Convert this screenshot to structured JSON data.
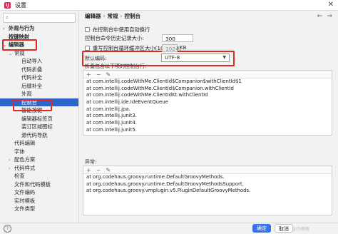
{
  "window": {
    "title": "设置",
    "app_icon": "intellij-icon"
  },
  "search": {
    "placeholder": ""
  },
  "tree": [
    {
      "label": "外观与行为",
      "level": 0,
      "arrow": "›",
      "bold": true
    },
    {
      "label": "按键映射",
      "level": 0,
      "arrow": "",
      "bold": true
    },
    {
      "label": "编辑器",
      "level": 0,
      "arrow": "⌄",
      "bold": true
    },
    {
      "label": "常规",
      "level": 1,
      "arrow": "⌄"
    },
    {
      "label": "自动导入",
      "level": 2,
      "arrow": ""
    },
    {
      "label": "代码折叠",
      "level": 2,
      "arrow": ""
    },
    {
      "label": "代码补全",
      "level": 2,
      "arrow": ""
    },
    {
      "label": "后缀补全",
      "level": 2,
      "arrow": ""
    },
    {
      "label": "外观",
      "level": 2,
      "arrow": ""
    },
    {
      "label": "控制台",
      "level": 2,
      "arrow": "",
      "selected": true
    },
    {
      "label": "智能按键",
      "level": 2,
      "arrow": "›"
    },
    {
      "label": "编辑器标签页",
      "level": 2,
      "arrow": ""
    },
    {
      "label": "装订区域图标",
      "level": 2,
      "arrow": ""
    },
    {
      "label": "源代码导航",
      "level": 2,
      "arrow": ""
    },
    {
      "label": "代码编辑",
      "level": 1,
      "arrow": ""
    },
    {
      "label": "字体",
      "level": 1,
      "arrow": ""
    },
    {
      "label": "配色方案",
      "level": 1,
      "arrow": "›"
    },
    {
      "label": "代码样式",
      "level": 1,
      "arrow": "›"
    },
    {
      "label": "检查",
      "level": 1,
      "arrow": ""
    },
    {
      "label": "文件和代码模板",
      "level": 1,
      "arrow": ""
    },
    {
      "label": "文件编码",
      "level": 1,
      "arrow": ""
    },
    {
      "label": "实时模板",
      "level": 1,
      "arrow": ""
    },
    {
      "label": "文件类型",
      "level": 1,
      "arrow": ""
    }
  ],
  "breadcrumb": {
    "part1": "编辑器",
    "part2": "常规",
    "part3": "控制台"
  },
  "settings": {
    "soft_wrap_label": "在控制台中使用自动换行",
    "history_label": "控制台命令历史记录大小:",
    "history_value": "300",
    "cyclic_buffer_label": "重写控制台循环缓冲区大小(1024 KB)",
    "cyclic_buffer_value": "1024",
    "cyclic_buffer_unit": "KB",
    "encoding_label": "默认编码:",
    "encoding_value": "UTF-8",
    "fold_label": "折叠包含以下项的控制台行:",
    "fold_lines": [
      "at com.intellij.codeWithMe.ClientId$Companion$withClientId$1",
      "at com.intellij.codeWithMe.ClientId$Companion.withClientId",
      "at com.intellij.codeWithMe.ClientIdKt.withClientId",
      "at com.intellij.ide.IdeEventQueue",
      "at com.intellij.jpa.",
      "at com.intellij.junit3.",
      "at com.intellij.junit4.",
      "at com.intellij.junit5."
    ],
    "exceptions_label": "异常:",
    "exception_lines": [
      "at org.codehaus.groovy.runtime.DefaultGroovyMethods.",
      "at org.codehaus.groovy.runtime.DefaultGroovyMethodsSupport.",
      "at org.codehaus.groovy.vmplugin.v5.PluginDefaultGroovyMethods."
    ]
  },
  "toolbar": {
    "add": "+",
    "remove": "−",
    "edit": "✎"
  },
  "footer": {
    "ok_label": "确定",
    "cancel_label": "取消",
    "help": "?",
    "watermark": "CSDN @冷雨夜"
  },
  "colors": {
    "selection": "#2f65ca",
    "highlight_box": "#e0281f",
    "primary_button": "#3574f0"
  }
}
